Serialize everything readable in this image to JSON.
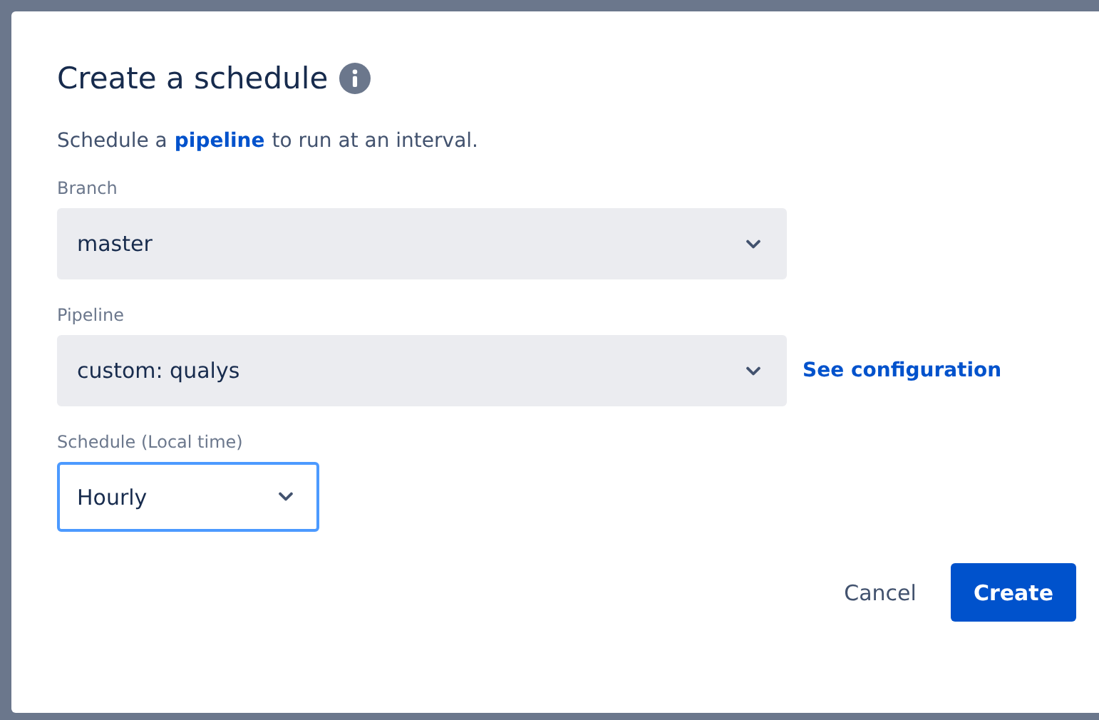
{
  "dialog": {
    "title": "Create a schedule",
    "description": {
      "before": "Schedule a",
      "link": "pipeline",
      "after": "to run at an interval."
    },
    "fields": [
      {
        "label": "Branch",
        "value": "master",
        "kind": "wide",
        "focused": false
      },
      {
        "label": "Pipeline",
        "value": "custom: qualys",
        "kind": "wide",
        "focused": false,
        "link": "See configuration"
      },
      {
        "label": "Schedule (Local time)",
        "value": "Hourly",
        "kind": "compact",
        "focused": true
      }
    ],
    "buttons": [
      {
        "label": "Cancel",
        "kind": "subtle"
      },
      {
        "label": "Create",
        "kind": "primary"
      }
    ]
  }
}
